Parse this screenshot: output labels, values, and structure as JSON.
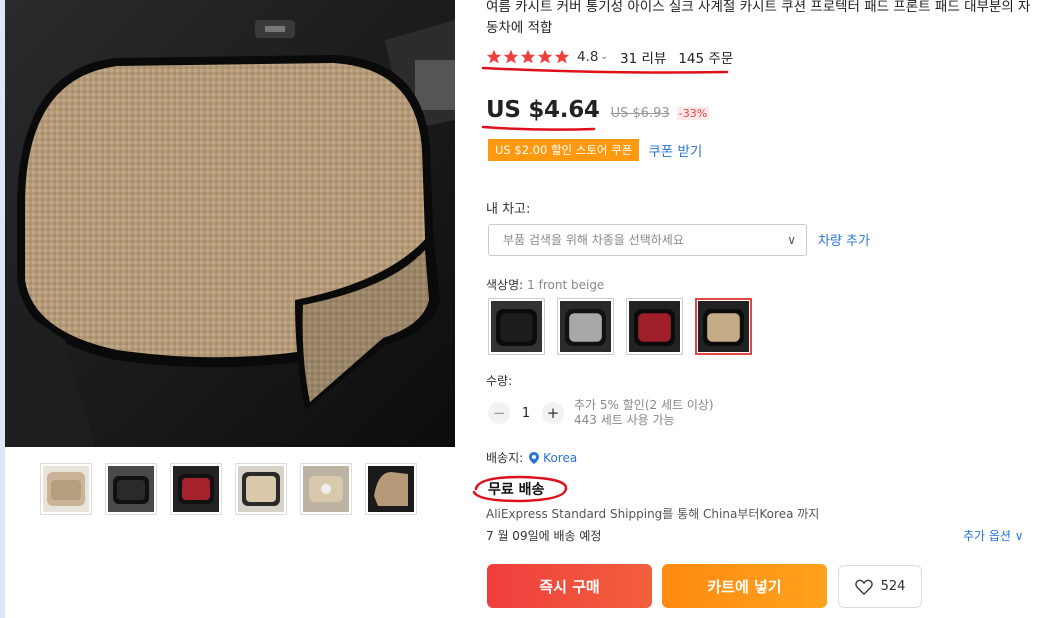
{
  "product": {
    "title": "여름 카시트 커버 통기성 아이스 실크 사계절 카시트 쿠션 프로텍터 패드 프론트 패드 대부분의 자동차에 적합",
    "rating_value": "4.8",
    "reviews": "31 리뷰",
    "orders": "145 주문",
    "price": "US $4.64",
    "original_price": "US $6.93",
    "discount": "-33%",
    "coupon_tag": "US $2.00 할인 스토어 쿠폰",
    "coupon_link": "쿠폰 받기"
  },
  "vehicle": {
    "label": "내 차고:",
    "placeholder": "부품 검색을 위해 차종을 선택하세요",
    "add_link": "차량 추가"
  },
  "color": {
    "label": "색상명:",
    "selected_value": "1 front beige",
    "options": [
      "black",
      "gray",
      "red",
      "beige"
    ]
  },
  "quantity": {
    "label": "수량:",
    "value": "1",
    "minus": "−",
    "plus": "+",
    "note_line1": "추가 5% 할인(2 세트 이상)",
    "note_line2": "443 세트 사용 가능"
  },
  "shipping": {
    "label": "배송지:",
    "country": "Korea",
    "free": "무료 배송",
    "detail": "AliExpress Standard Shipping를 통해 China부터Korea 까지",
    "date": "7 월 09일에 배송 예정",
    "more_options": "추가 옵션 ∨"
  },
  "actions": {
    "buy_now": "즉시 구매",
    "add_to_cart": "카트에 넣기",
    "wishlist_count": "524"
  },
  "colors": {
    "accent_red": "#f03e3e",
    "accent_orange": "#ff9a10",
    "link_blue": "#2a74d8",
    "annotation_red": "#e0101a"
  }
}
